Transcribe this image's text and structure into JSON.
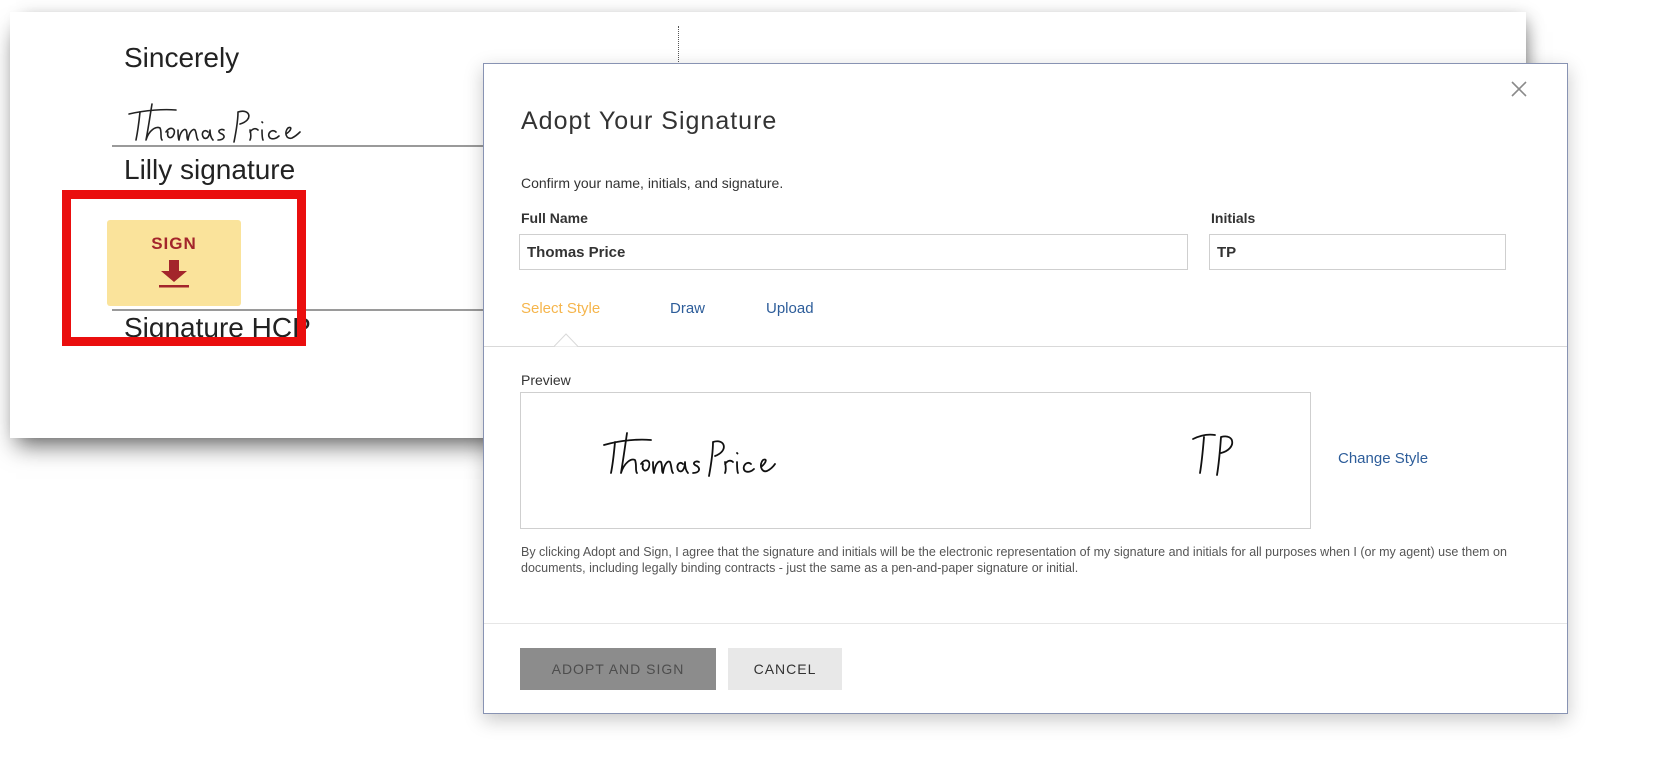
{
  "document": {
    "closing": "Sincerely",
    "signature_script": "Thomas Price",
    "signer_label_1": "Lilly signature",
    "sign_button_label": "SIGN",
    "signer_label_2": "Signature HCP"
  },
  "dialog": {
    "title": "Adopt Your Signature",
    "subtitle": "Confirm your name, initials, and signature.",
    "full_name_label": "Full Name",
    "full_name_value": "Thomas Price",
    "initials_label": "Initials",
    "initials_value": "TP",
    "tabs": [
      {
        "label": "Select Style",
        "active": true
      },
      {
        "label": "Draw",
        "active": false
      },
      {
        "label": "Upload",
        "active": false
      }
    ],
    "preview_label": "Preview",
    "preview_signature": "Thomas Price",
    "preview_initials": "TP",
    "change_style_label": "Change Style",
    "disclaimer": "By clicking Adopt and Sign, I agree that the signature and initials will be the electronic representation of my signature and initials for all purposes when I (or my agent) use them on documents, including legally binding contracts - just the same as a pen-and-paper signature or initial.",
    "adopt_button_label": "ADOPT AND SIGN",
    "cancel_button_label": "CANCEL"
  },
  "colors": {
    "highlight": "#ea0e0e",
    "sign_button_bg": "#fae39b",
    "sign_button_text": "#a3252b",
    "active_tab": "#f5b54c",
    "link": "#2d5d9a",
    "adopt_button_bg": "#8c8c8c"
  },
  "icons": {
    "close": "close-icon",
    "sign_arrow": "down-arrow-icon"
  }
}
